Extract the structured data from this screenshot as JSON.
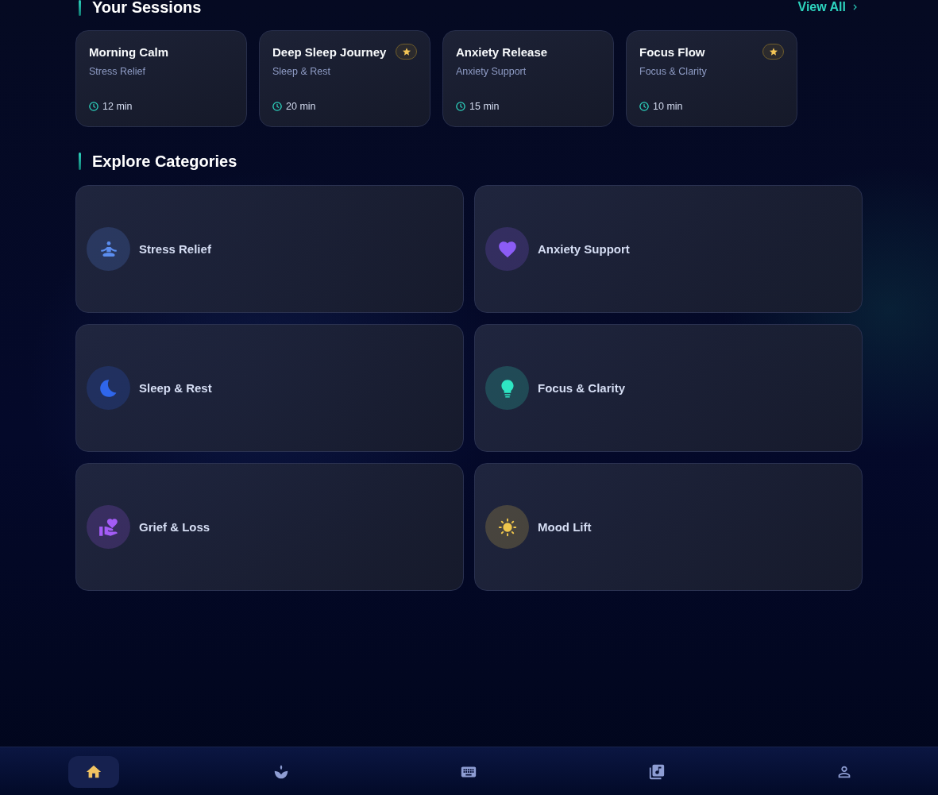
{
  "sessions_section": {
    "title": "Your Sessions",
    "view_all": "View All"
  },
  "sessions": [
    {
      "title": "Morning Calm",
      "category": "Stress Relief",
      "duration": "12 min",
      "favorite": false
    },
    {
      "title": "Deep Sleep Journey",
      "category": "Sleep & Rest",
      "duration": "20 min",
      "favorite": true
    },
    {
      "title": "Anxiety Release",
      "category": "Anxiety Support",
      "duration": "15 min",
      "favorite": false
    },
    {
      "title": "Focus Flow",
      "category": "Focus & Clarity",
      "duration": "10 min",
      "favorite": true
    }
  ],
  "categories_section": {
    "title": "Explore Categories"
  },
  "categories": [
    {
      "label": "Stress Relief",
      "kind": "meditation",
      "color": "#5b8def"
    },
    {
      "label": "Anxiety Support",
      "kind": "heart",
      "color": "#8b5cf6"
    },
    {
      "label": "Sleep & Rest",
      "kind": "moon",
      "color": "#2f66eb"
    },
    {
      "label": "Focus & Clarity",
      "kind": "lightbulb",
      "color": "#2ee6c3"
    },
    {
      "label": "Grief & Loss",
      "kind": "care",
      "color": "#a45cf6"
    },
    {
      "label": "Mood Lift",
      "kind": "sun",
      "color": "#efc64c"
    }
  ],
  "bottom_nav": [
    {
      "kind": "home",
      "selected": true
    },
    {
      "kind": "lotus",
      "selected": false
    },
    {
      "kind": "keyboard",
      "selected": false
    },
    {
      "kind": "music",
      "selected": false
    },
    {
      "kind": "profile",
      "selected": false
    }
  ]
}
